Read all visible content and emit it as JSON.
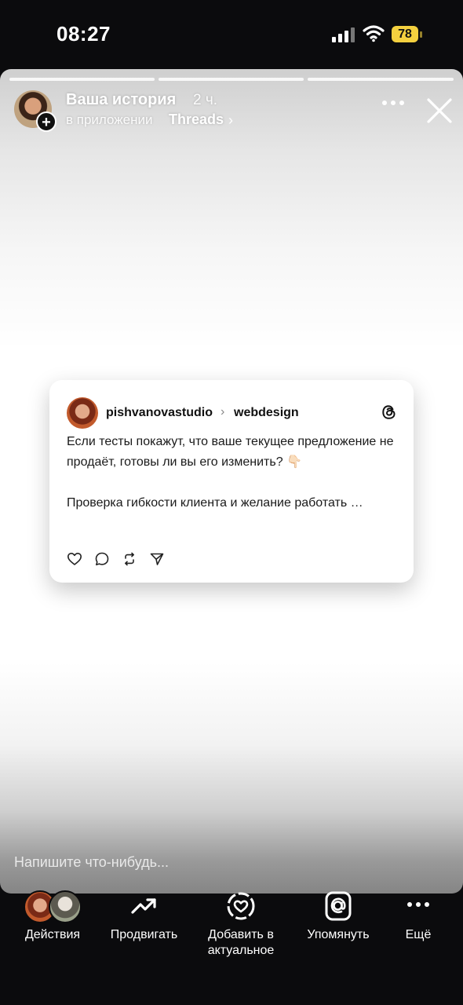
{
  "status_bar": {
    "time": "08:27",
    "battery_level": "78",
    "battery_color": "#f4d03f"
  },
  "story": {
    "progress_segments": 3,
    "title": "Ваша история",
    "time_ago": "2 ч.",
    "subtitle_prefix": "в приложении",
    "subtitle_app": "Threads",
    "subtitle_chevron": "›",
    "avatar_add": "+"
  },
  "post": {
    "username": "pishvanovastudio",
    "separator": "›",
    "topic": "webdesign",
    "paragraph1": "Если тесты покажут, что ваше текущее предложение не продаёт, готовы ли вы его изменить? 👇🏻",
    "paragraph2": "Проверка гибкости клиента и желание работать …",
    "actions": [
      "heart-icon",
      "comment-icon",
      "repost-icon",
      "share-icon"
    ]
  },
  "reply": {
    "placeholder": "Напишите что-нибудь..."
  },
  "bottom_bar": {
    "activity": "Действия",
    "promote": "Продвигать",
    "highlight_line1": "Добавить в",
    "highlight_line2": "актуальное",
    "mention": "Упомянуть",
    "more": "Ещё"
  }
}
